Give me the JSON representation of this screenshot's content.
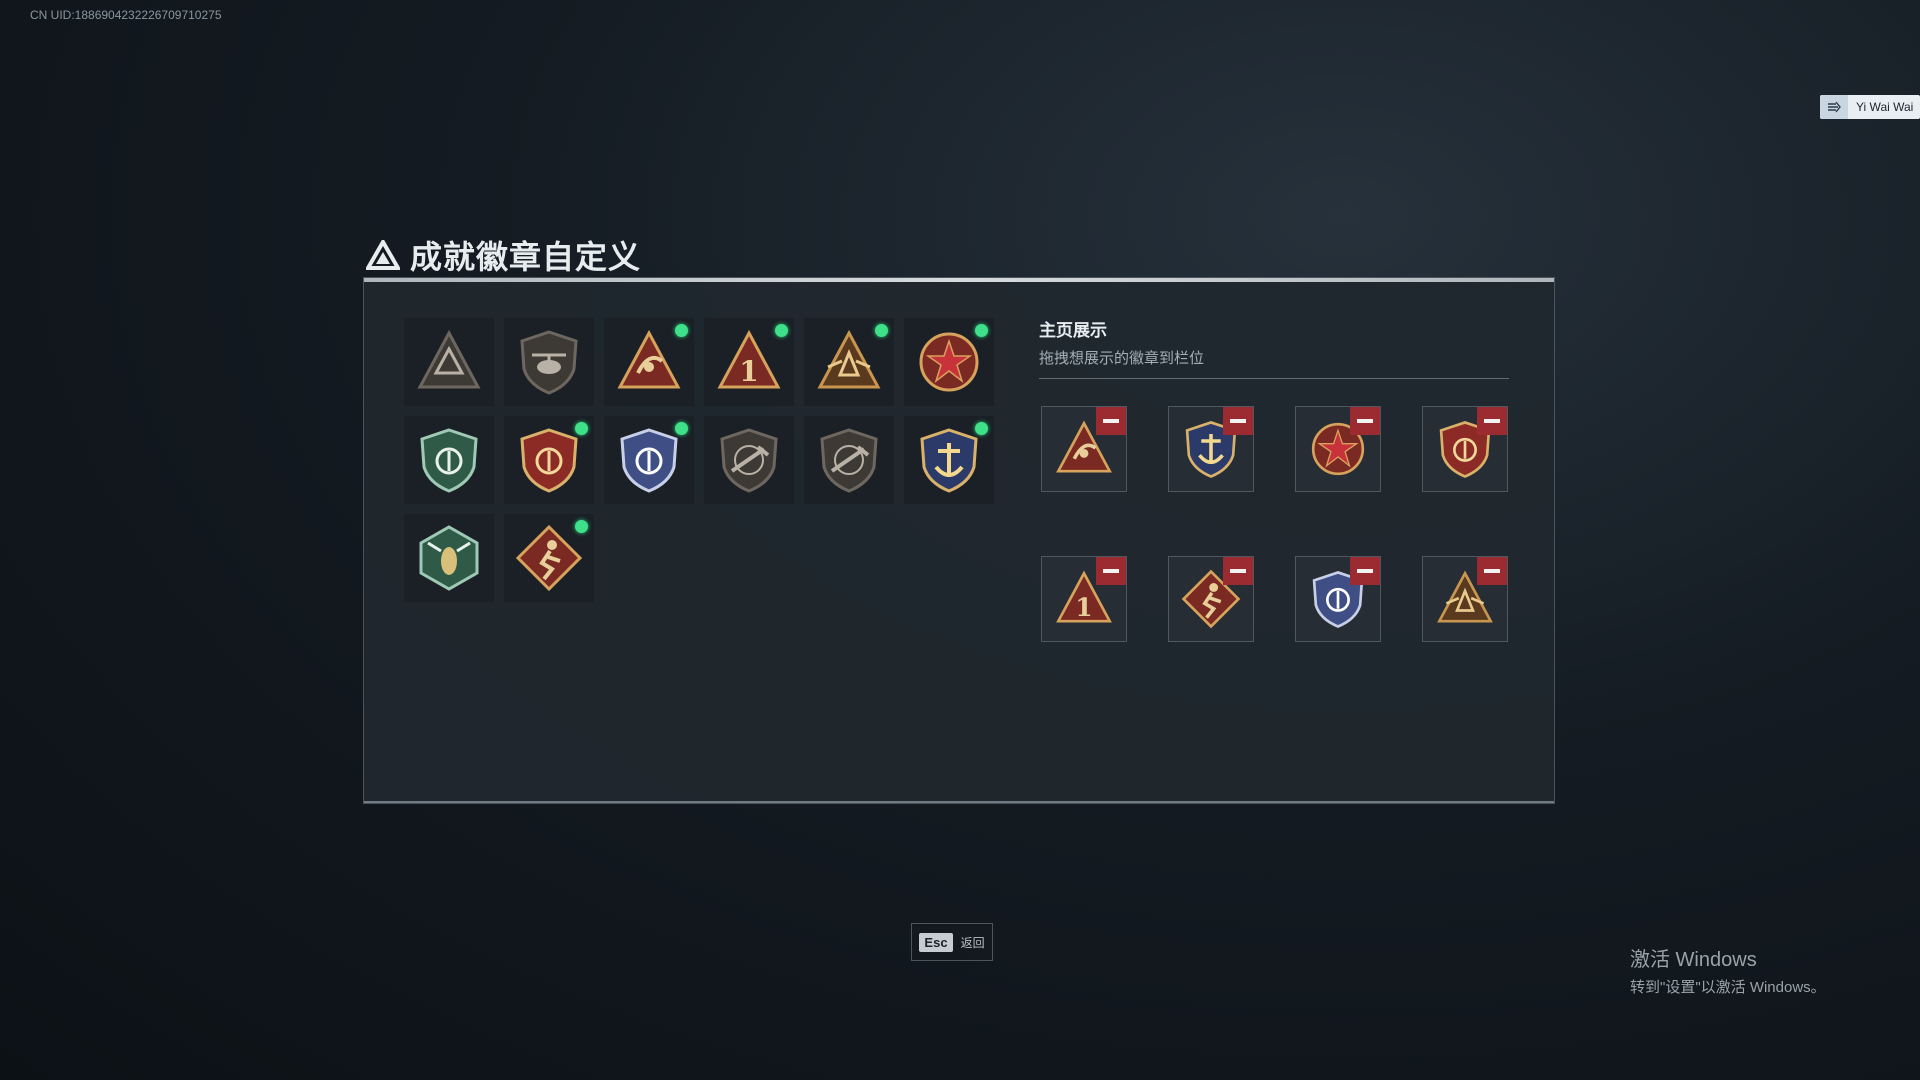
{
  "uid": "CN UID:1886904232226709710275",
  "user": {
    "name": "Yi Wai Wai"
  },
  "title": "成就徽章自定义",
  "badges": [
    {
      "id": "b1",
      "icon": "triangle-shield-badge-icon",
      "style": "dark",
      "new": false
    },
    {
      "id": "b2",
      "icon": "helicopter-shield-badge-icon",
      "style": "dark",
      "new": false
    },
    {
      "id": "b3",
      "icon": "radar-dish-triangle-badge-icon",
      "style": "red",
      "new": true
    },
    {
      "id": "b4",
      "icon": "number-one-triangle-badge-icon",
      "style": "red",
      "new": true
    },
    {
      "id": "b5",
      "icon": "winged-triangle-badge-icon",
      "style": "bronze",
      "new": true
    },
    {
      "id": "b6",
      "icon": "star-wreath-badge-icon",
      "style": "red",
      "new": true
    },
    {
      "id": "b7",
      "icon": "green-beret-shield-badge-icon",
      "style": "green",
      "new": false
    },
    {
      "id": "b8",
      "icon": "starred-crest-badge-icon",
      "style": "navy",
      "new": true
    },
    {
      "id": "b9",
      "icon": "blue-shield-badge-icon",
      "style": "blue",
      "new": true
    },
    {
      "id": "b10",
      "icon": "rifle-shield-badge-icon",
      "style": "dark",
      "new": false
    },
    {
      "id": "b11",
      "icon": "rifle-shield-badge-icon",
      "style": "dark",
      "new": false
    },
    {
      "id": "b12",
      "icon": "anchor-crest-badge-icon",
      "style": "gold",
      "new": true
    },
    {
      "id": "b13",
      "icon": "wasp-hexagon-badge-icon",
      "style": "green",
      "new": false
    },
    {
      "id": "b14",
      "icon": "runner-diamond-badge-icon",
      "style": "red",
      "new": true
    }
  ],
  "showcase": {
    "title": "主页展示",
    "subtitle": "拖拽想展示的徽章到栏位",
    "slots": [
      {
        "icon": "radar-dish-triangle-badge-icon",
        "style": "red"
      },
      {
        "icon": "anchor-crest-badge-icon",
        "style": "gold"
      },
      {
        "icon": "star-wreath-badge-icon",
        "style": "red"
      },
      {
        "icon": "starred-crest-badge-icon",
        "style": "navy"
      },
      {
        "icon": "number-one-triangle-badge-icon",
        "style": "red"
      },
      {
        "icon": "runner-diamond-badge-icon",
        "style": "red"
      },
      {
        "icon": "blue-shield-badge-icon",
        "style": "blue"
      },
      {
        "icon": "winged-triangle-badge-icon",
        "style": "bronze"
      }
    ]
  },
  "esc": {
    "key": "Esc",
    "label": "返回"
  },
  "watermark": {
    "line1": "激活 Windows",
    "line2": "转到\"设置\"以激活 Windows。"
  },
  "colors": {
    "new_dot": "#3ee08a",
    "remove": "#9c2a31",
    "accent": "#d9b16a"
  }
}
